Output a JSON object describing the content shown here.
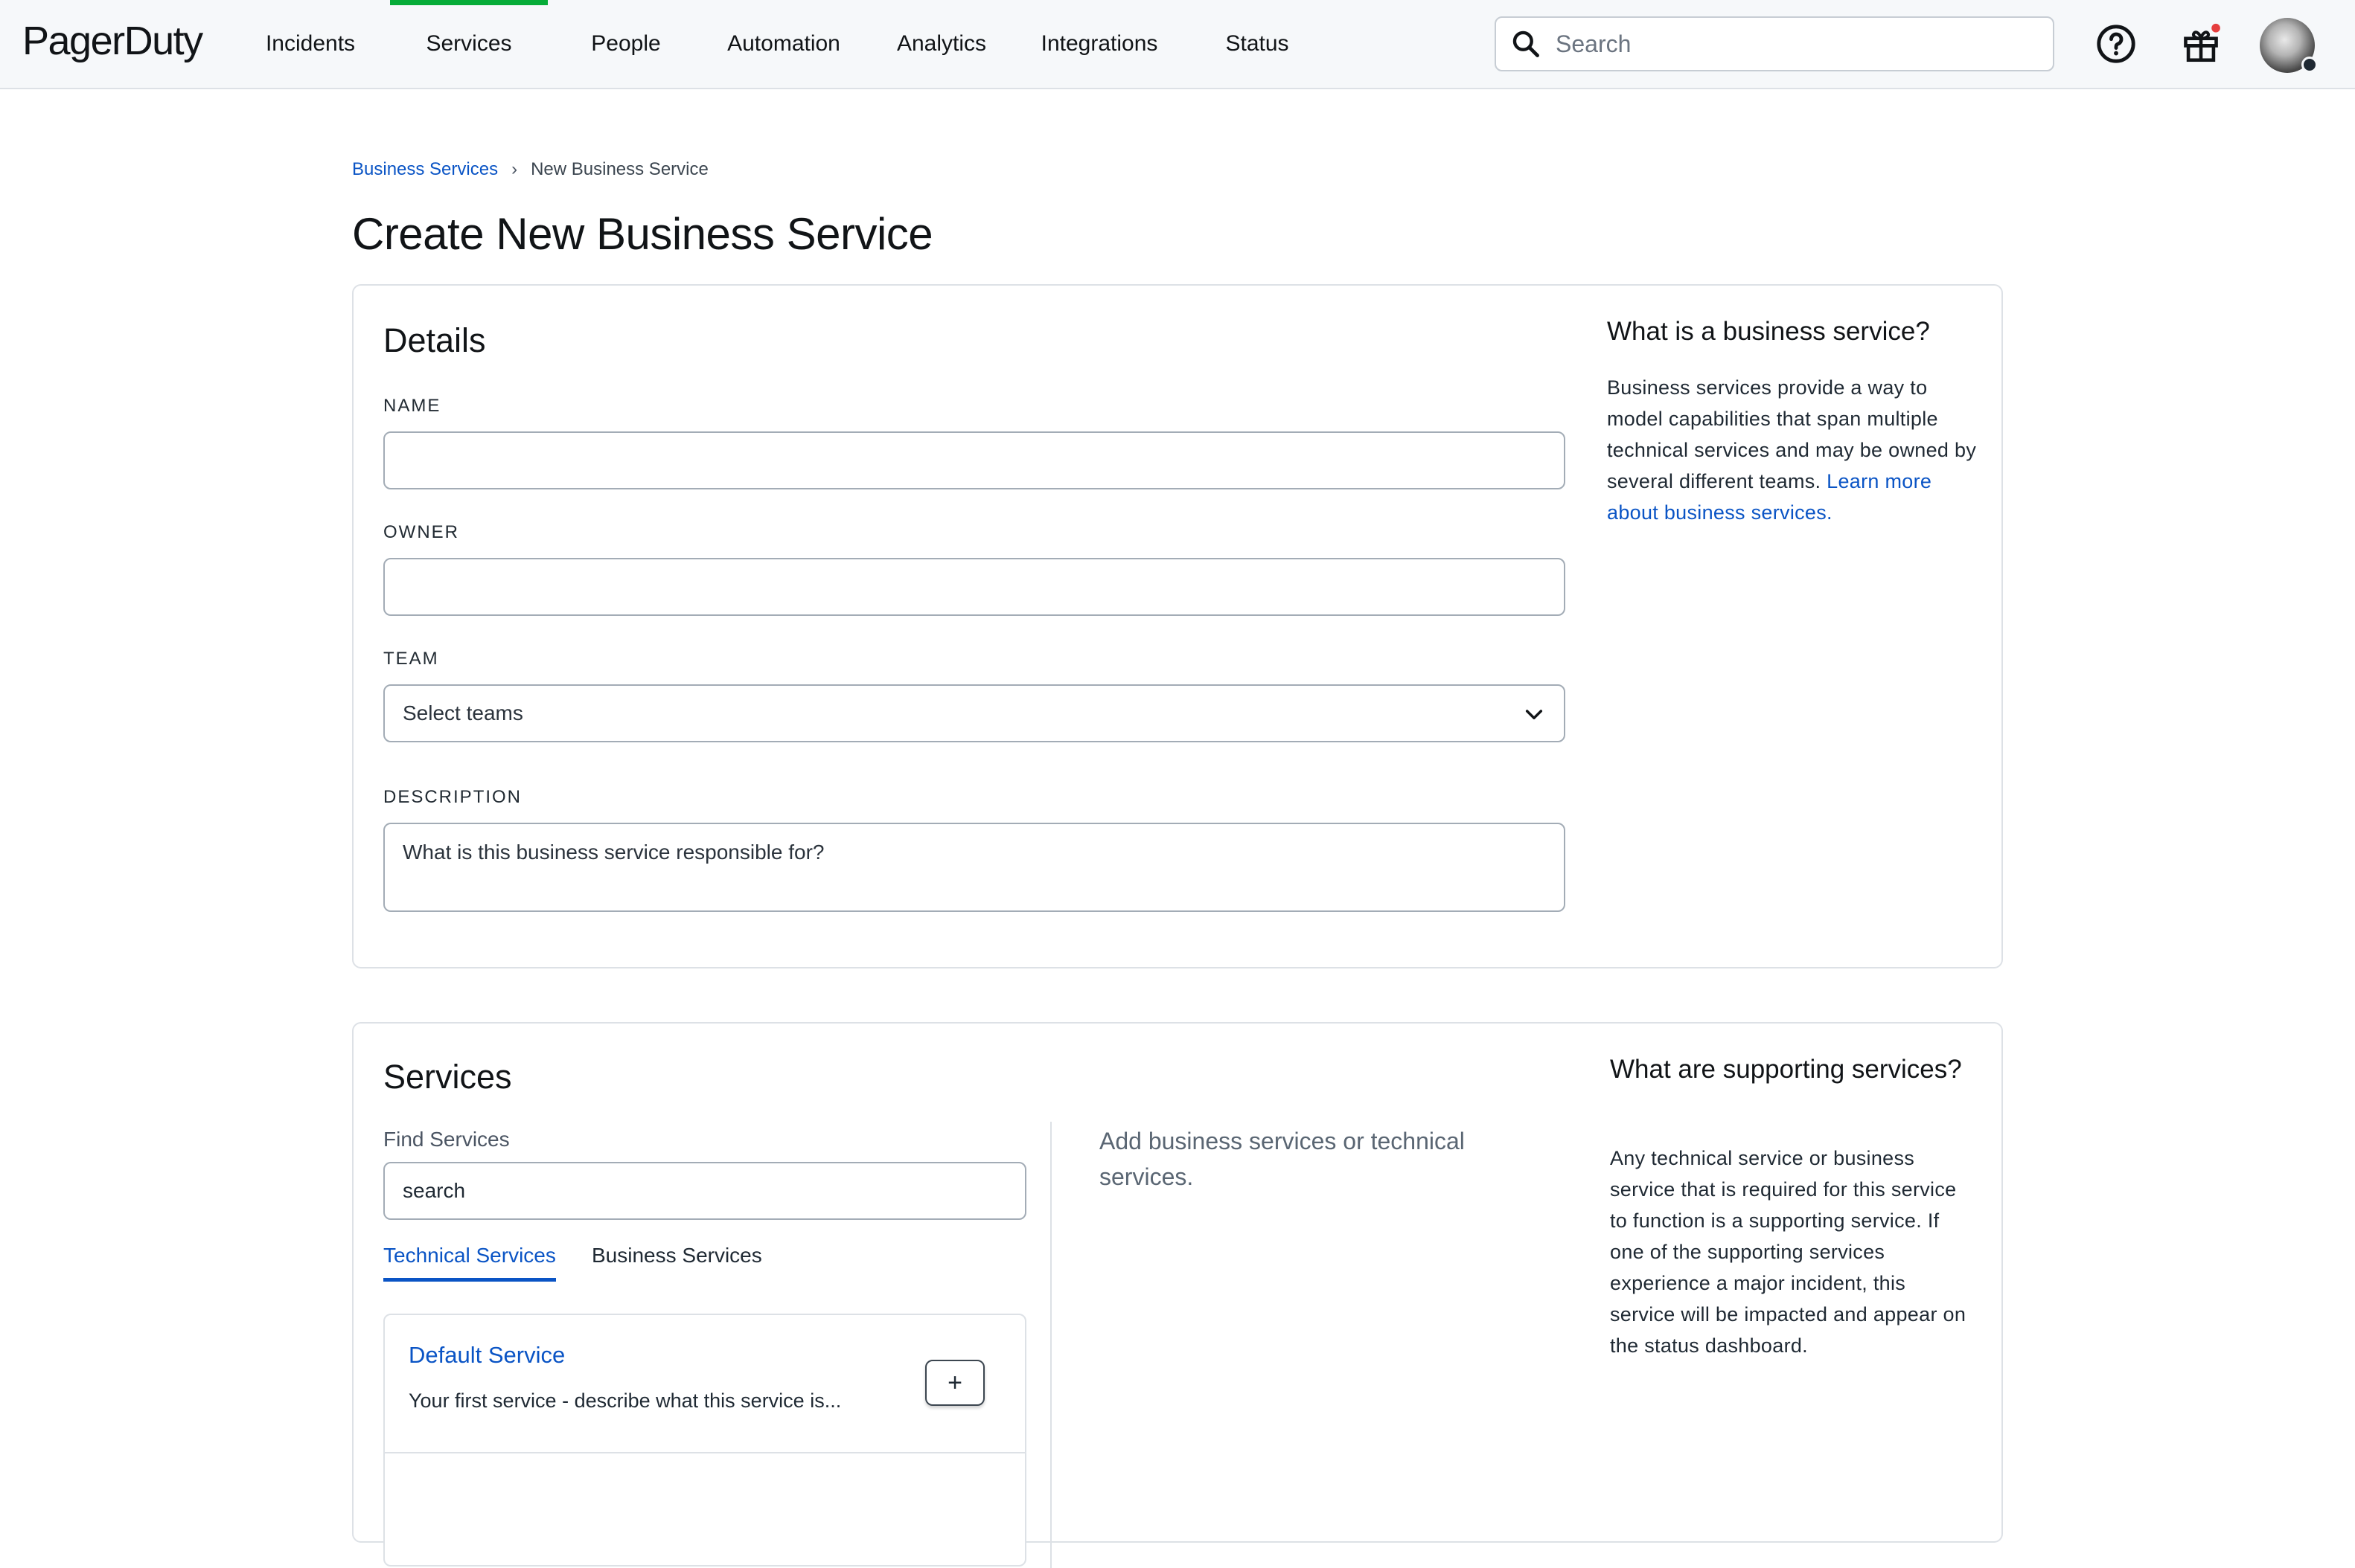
{
  "nav": {
    "brand": "PagerDuty",
    "items": [
      {
        "label": "Incidents"
      },
      {
        "label": "Services"
      },
      {
        "label": "People"
      },
      {
        "label": "Automation"
      },
      {
        "label": "Analytics"
      },
      {
        "label": "Integrations"
      },
      {
        "label": "Status"
      }
    ],
    "active_item": "Services",
    "search_placeholder": "Search",
    "accent_color": "#06ac38",
    "notification_dot_color": "#e53e3e"
  },
  "breadcrumb": {
    "parent": "Business Services",
    "separator": "›",
    "current": "New Business Service"
  },
  "page": {
    "title": "Create New Business Service"
  },
  "details": {
    "title": "Details",
    "name_label": "NAME",
    "name_value": "",
    "owner_label": "OWNER",
    "owner_value": "",
    "team_label": "TEAM",
    "team_value": "Select teams",
    "description_label": "DESCRIPTION",
    "description_placeholder": "What is this business service responsible for?",
    "help_title": "What is a business service?",
    "help_text": "Business services provide a way to model capabilities that span multiple technical services and may be owned by several different teams.",
    "help_link": "Learn more about business services."
  },
  "services": {
    "title": "Services",
    "find_label": "Find Services",
    "find_value": "search",
    "tabs": [
      {
        "label": "Technical Services",
        "active": true
      },
      {
        "label": "Business Services",
        "active": false
      }
    ],
    "list": [
      {
        "name": "Default Service",
        "description": "Your first service - describe what this service is...",
        "action": "+"
      }
    ],
    "empty_text": "Add business services or technical services.",
    "help_title": "What are supporting services?",
    "help_text": "Any technical service or business service that is required for this service to function is a supporting service. If one of the supporting services experience a major incident, this service will be impacted and appear on the status dashboard."
  },
  "colors": {
    "link": "#0a54c5",
    "border": "#dde1e6",
    "input_border": "#a3acb6"
  }
}
